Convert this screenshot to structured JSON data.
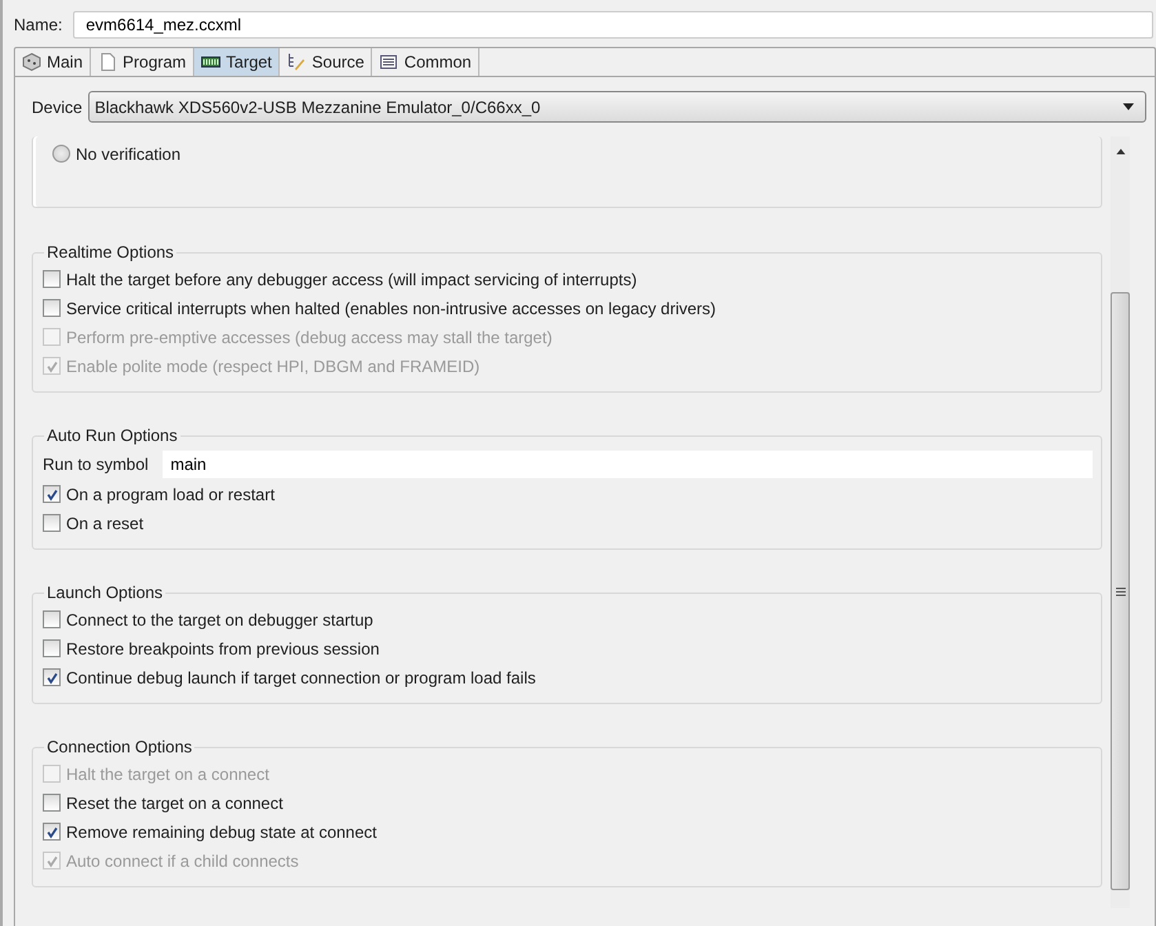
{
  "name_field": {
    "label": "Name:",
    "value": "evm6614_mez.ccxml"
  },
  "tabs": [
    {
      "label": "Main",
      "kind": "cube",
      "selected": false
    },
    {
      "label": "Program",
      "kind": "page",
      "selected": false
    },
    {
      "label": "Target",
      "kind": "board",
      "selected": true
    },
    {
      "label": "Source",
      "kind": "tree",
      "selected": false
    },
    {
      "label": "Common",
      "kind": "list",
      "selected": false
    }
  ],
  "device": {
    "label": "Device",
    "value": "Blackhawk XDS560v2-USB Mezzanine Emulator_0/C66xx_0"
  },
  "groups": [
    {
      "items": [
        {
          "kind": "radio",
          "label": "No verification",
          "selected": false,
          "disabled": false
        }
      ]
    },
    {
      "title": "Realtime Options",
      "items": [
        {
          "kind": "checkbox",
          "label": "Halt the target before any debugger access (will impact servicing of interrupts)",
          "checked": false,
          "disabled": false
        },
        {
          "kind": "checkbox",
          "label": "Service critical interrupts when halted (enables non-intrusive accesses on legacy drivers)",
          "checked": false,
          "disabled": false
        },
        {
          "kind": "checkbox",
          "label": "Perform pre-emptive accesses (debug access may stall the target)",
          "checked": false,
          "disabled": true
        },
        {
          "kind": "checkbox",
          "label": "Enable polite mode (respect HPI, DBGM and FRAMEID)",
          "checked": true,
          "disabled": true
        }
      ]
    },
    {
      "title": "Auto Run Options",
      "items": [
        {
          "kind": "field",
          "label": "Run to symbol",
          "value": "main"
        },
        {
          "kind": "checkbox",
          "label": "On a program load or restart",
          "checked": true,
          "disabled": false
        },
        {
          "kind": "checkbox",
          "label": "On a reset",
          "checked": false,
          "disabled": false
        }
      ]
    },
    {
      "title": "Launch Options",
      "items": [
        {
          "kind": "checkbox",
          "label": "Connect to the target on debugger startup",
          "checked": false,
          "disabled": false
        },
        {
          "kind": "checkbox",
          "label": "Restore breakpoints from previous session",
          "checked": false,
          "disabled": false
        },
        {
          "kind": "checkbox",
          "label": "Continue debug launch if target connection or program load fails",
          "checked": true,
          "disabled": false
        }
      ]
    },
    {
      "title": "Connection Options",
      "items": [
        {
          "kind": "checkbox",
          "label": "Halt the target on a connect",
          "checked": false,
          "disabled": true
        },
        {
          "kind": "checkbox",
          "label": "Reset the target on a connect",
          "checked": false,
          "disabled": false
        },
        {
          "kind": "checkbox",
          "label": "Remove remaining debug state at connect",
          "checked": true,
          "disabled": false
        },
        {
          "kind": "checkbox",
          "label": "Auto connect if a child connects",
          "checked": true,
          "disabled": true
        }
      ]
    }
  ]
}
